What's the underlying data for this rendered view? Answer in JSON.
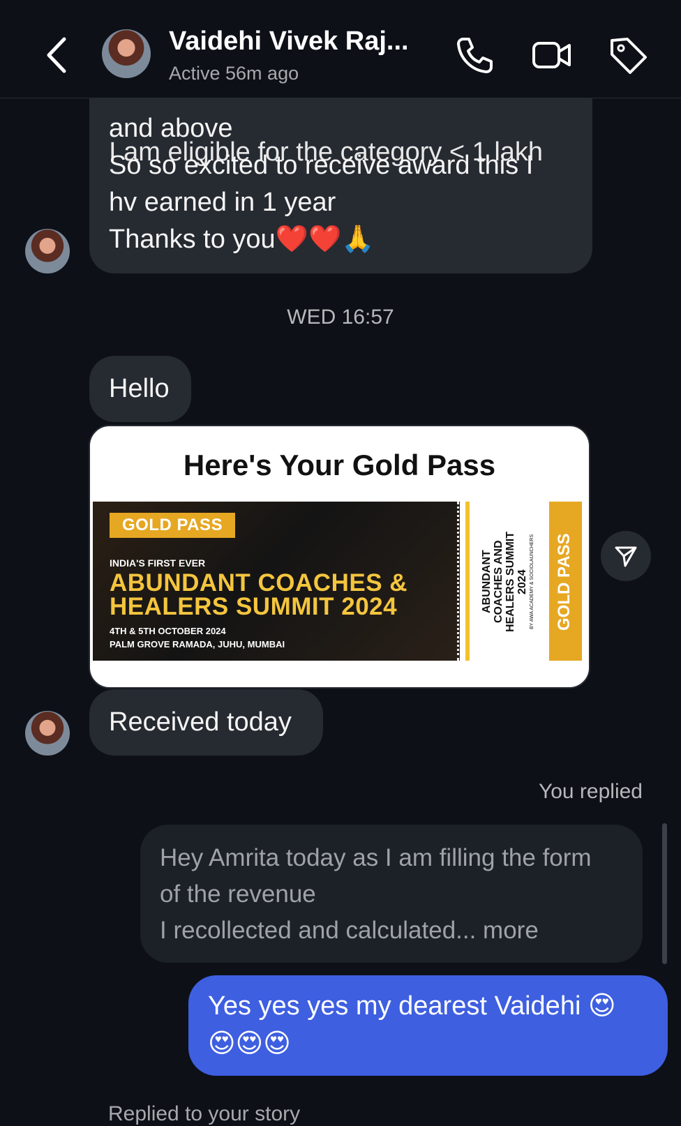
{
  "header": {
    "contact_name": "Vaidehi Vivek Raj...",
    "status": "Active 56m ago",
    "icons": [
      "back-arrow-icon",
      "phone-icon",
      "video-icon",
      "tag-icon"
    ]
  },
  "messages": {
    "cut_line": "I am eligible for the category < 1 lakh",
    "msg1_lines": [
      "and above",
      "So so excited to receive award this I",
      "hv earned in 1 year",
      "Thanks to you❤️❤️🙏"
    ],
    "timestamp": "WED 16:57",
    "hello": "Hello",
    "pass": {
      "title": "Here's Your Gold Pass",
      "badge": "GOLD PASS",
      "first_ever": "INDIA'S FIRST EVER",
      "summit_line1": "ABUNDANT COACHES &",
      "summit_line2": "HEALERS SUMMIT 2024",
      "date": "4TH & 5TH OCTOBER 2024",
      "venue": "PALM GROVE RAMADA, JUHU, MUMBAI",
      "side_title": "ABUNDANT COACHES AND HEALERS SUMMIT 2024",
      "side_credit": "BY AWA ACADEMY & SOCIOLAUNCHERS",
      "side_badge": "GOLD PASS"
    },
    "received": "Received today",
    "you_replied": "You replied",
    "reply_lines": [
      "Hey Amrita today as I am filling the form",
      "of the revenue",
      "I recollected and calculated... more"
    ],
    "mine_line1": "Yes yes yes my dearest Vaidehi 😍",
    "mine_line2": "😍😍😍",
    "footer": "Replied to your story"
  },
  "colors": {
    "background": "#0d1017",
    "incoming_bubble": "#262a31",
    "outgoing_bubble": "#3e5fe0",
    "gold": "#e6a722"
  }
}
